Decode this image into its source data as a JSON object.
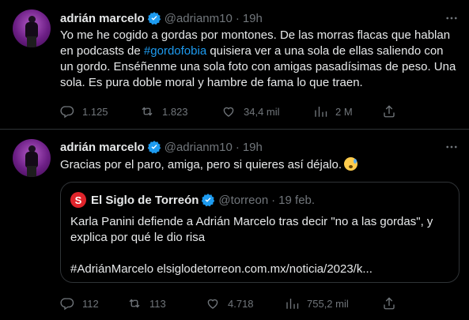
{
  "tweets": [
    {
      "author": {
        "name": "adrián marcelo",
        "handle": "@adrianm10",
        "separator": "·",
        "time": "19h"
      },
      "text": {
        "part1": "Yo me he cogido a gordas por montones. De las morras flacas que hablan en podcasts de ",
        "hashtag": "#gordofobia",
        "part2": " quisiera ver a una sola de ellas saliendo con un gordo. Enséñenme una sola foto con amigas pasadísimas de peso. Una sola. Es pura doble moral y hambre de fama lo que traen."
      },
      "stats": {
        "replies": "1.125",
        "retweets": "1.823",
        "likes": "34,4 mil",
        "views": "2 M"
      }
    },
    {
      "author": {
        "name": "adrián marcelo",
        "handle": "@adrianm10",
        "separator": "·",
        "time": "19h"
      },
      "text": {
        "part1": "Gracias por el paro, amiga, pero si quieres así déjalo."
      },
      "quote": {
        "logo": "S",
        "name": "El Siglo de Torreón",
        "handle": "@torreon",
        "separator": "·",
        "date": "19 feb.",
        "text": "Karla Panini defiende a Adrián Marcelo tras decir \"no a las gordas\", y explica por qué le dio risa",
        "link": "#AdriánMarcelo elsiglodetorreon.com.mx/noticia/2023/k..."
      },
      "stats": {
        "replies": "112",
        "retweets": "113",
        "likes": "4.718",
        "views": "755,2 mil"
      }
    }
  ],
  "icons": {
    "verified": "verified-badge-icon",
    "more": "more-options-icon",
    "reply": "reply-icon",
    "retweet": "retweet-icon",
    "like": "like-icon",
    "views": "views-icon",
    "share": "share-icon",
    "emoji": "anxious-face-emoji"
  },
  "colors": {
    "background": "#000000",
    "text": "#e7e9ea",
    "secondary": "#71767b",
    "accent": "#1d9bf0",
    "border": "#2f3336",
    "brand_logo": "#e0242b"
  }
}
